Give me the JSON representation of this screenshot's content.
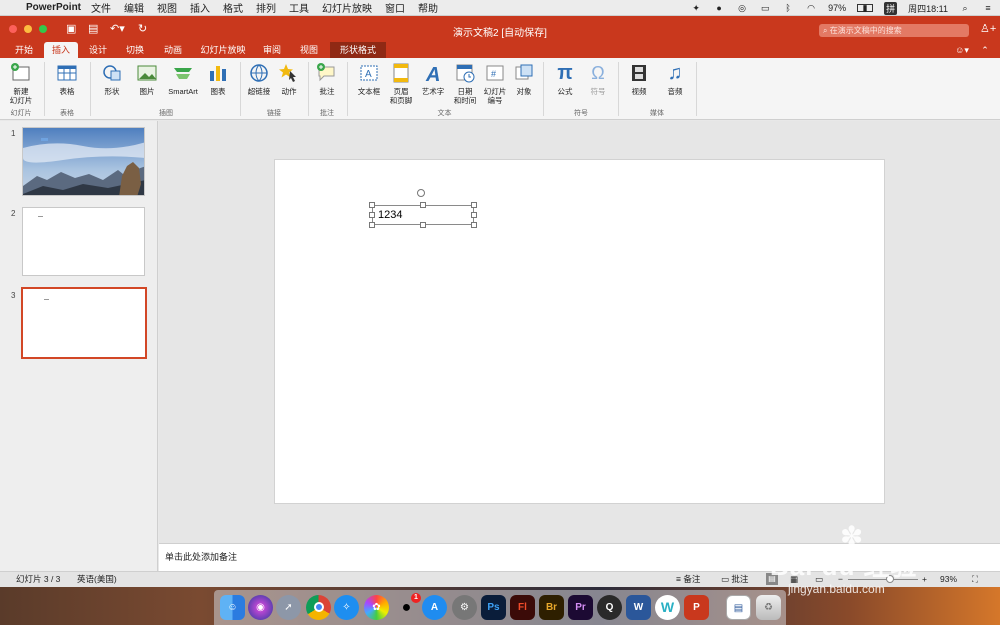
{
  "menubar": {
    "apple": "",
    "app_name": "PowerPoint",
    "items": [
      "文件",
      "编辑",
      "视图",
      "插入",
      "格式",
      "排列",
      "工具",
      "幻灯片放映",
      "窗口",
      "帮助"
    ],
    "battery": "97%",
    "ime": "拼",
    "clock": "周四18:11"
  },
  "window": {
    "title": "演示文稿2 [自动保存]",
    "search_placeholder": "在演示文稿中的搜索"
  },
  "tabs": [
    "开始",
    "插入",
    "设计",
    "切换",
    "动画",
    "幻灯片放映",
    "审阅",
    "视图",
    "形状格式"
  ],
  "ribbon": {
    "new_slide": [
      "新建",
      "幻灯片"
    ],
    "table": "表格",
    "shape": "形状",
    "picture": "图片",
    "smartart": "SmartArt",
    "chart": "图表",
    "hyperlink": "超链接",
    "action": "动作",
    "comment": "批注",
    "textbox": "文本框",
    "header_footer": [
      "页眉",
      "和页脚"
    ],
    "wordart": "艺术字",
    "datetime": [
      "日期",
      "和时间"
    ],
    "slide_number": [
      "幻灯片",
      "编号"
    ],
    "object": "对象",
    "equation": "公式",
    "symbol": "符号",
    "video": "视频",
    "audio": "音频",
    "groups": [
      "幻灯片",
      "表格",
      "插图",
      "链接",
      "批注",
      "文本",
      "符号",
      "媒体"
    ]
  },
  "slides": [
    {
      "num": "1"
    },
    {
      "num": "2"
    },
    {
      "num": "3"
    }
  ],
  "textbox": {
    "text": "1234"
  },
  "notes_placeholder": "单击此处添加备注",
  "status": {
    "slide_info": "幻灯片 3 / 3",
    "language": "英语(美国)",
    "notes": "备注",
    "comments": "批注",
    "zoom": "93%",
    "zoom_level": 0.93
  },
  "dock": {
    "ps": "Ps",
    "fl": "Fl",
    "br": "Br",
    "pr": "Pr",
    "word": "W",
    "ppt": "P",
    "qq_badge": "1"
  },
  "watermark": {
    "brand": "Bai du 经验",
    "url": "jingyan.baidu.com"
  }
}
